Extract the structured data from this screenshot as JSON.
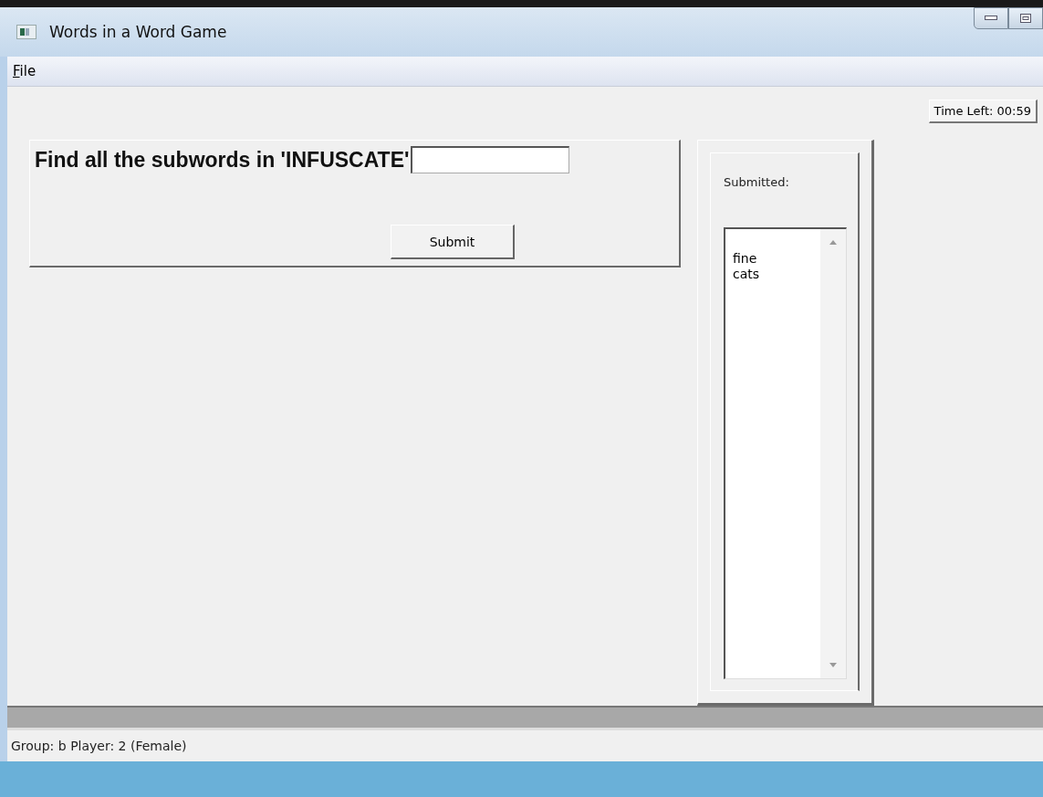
{
  "window": {
    "title": "Words in a Word Game"
  },
  "menu": [
    {
      "label": "File"
    }
  ],
  "timer": "Time Left: 00:59",
  "prompt": "Find all the subwords in 'INFUSCATE'",
  "submit_button": "Submit",
  "submitted": {
    "label": "Submitted:",
    "items": [
      "fine",
      "cats"
    ]
  },
  "status_bar": "Group: b Player: 2 (Female)"
}
